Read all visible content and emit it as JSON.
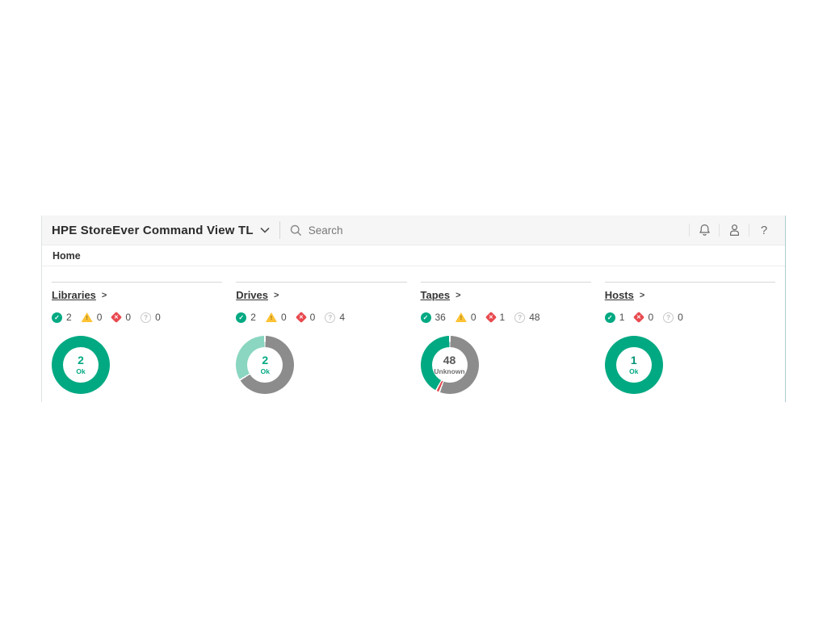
{
  "app": {
    "title": "HPE StoreEver Command View TL",
    "search_placeholder": "Search",
    "breadcrumb": "Home"
  },
  "ui": {
    "link_arrow": ">",
    "help_glyph": "?"
  },
  "status_glyphs": {
    "ok": "✓",
    "warning": "!",
    "error": "✕",
    "unknown": "?"
  },
  "status_colors": {
    "ok": "#01a982",
    "ok_light": "#8ad6c0",
    "warning": "#fdc234",
    "error": "#e8494f",
    "unknown": "#8c8c8c"
  },
  "panels": [
    {
      "title": "Libraries",
      "statuses": [
        {
          "type": "ok",
          "count": "2"
        },
        {
          "type": "warning",
          "count": "0"
        },
        {
          "type": "error",
          "count": "0"
        },
        {
          "type": "unknown",
          "count": "0"
        }
      ],
      "donut": {
        "center_value": "2",
        "center_label": "Ok",
        "center_value_color": "#01a982",
        "center_label_color": "#01a982",
        "segments": [
          {
            "label": "ok",
            "value": 2,
            "color": "#01a982"
          }
        ]
      }
    },
    {
      "title": "Drives",
      "statuses": [
        {
          "type": "ok",
          "count": "2"
        },
        {
          "type": "warning",
          "count": "0"
        },
        {
          "type": "error",
          "count": "0"
        },
        {
          "type": "unknown",
          "count": "4"
        }
      ],
      "donut": {
        "center_value": "2",
        "center_label": "Ok",
        "center_value_color": "#01a982",
        "center_label_color": "#01a982",
        "segments": [
          {
            "label": "unknown",
            "value": 4,
            "color": "#8c8c8c"
          },
          {
            "label": "ok",
            "value": 2,
            "color": "#8ad6c0"
          }
        ]
      }
    },
    {
      "title": "Tapes",
      "statuses": [
        {
          "type": "ok",
          "count": "36"
        },
        {
          "type": "warning",
          "count": "0"
        },
        {
          "type": "error",
          "count": "1"
        },
        {
          "type": "unknown",
          "count": "48"
        }
      ],
      "donut": {
        "center_value": "48",
        "center_label": "Unknown",
        "center_value_color": "#585858",
        "center_label_color": "#6f6f6f",
        "segments": [
          {
            "label": "unknown",
            "value": 48,
            "color": "#8c8c8c"
          },
          {
            "label": "error",
            "value": 1,
            "color": "#e0494f"
          },
          {
            "label": "ok",
            "value": 36,
            "color": "#01a982"
          }
        ]
      }
    },
    {
      "title": "Hosts",
      "statuses": [
        {
          "type": "ok",
          "count": "1"
        },
        {
          "type": "error",
          "count": "0"
        },
        {
          "type": "unknown",
          "count": "0"
        }
      ],
      "donut": {
        "center_value": "1",
        "center_label": "Ok",
        "center_value_color": "#019378",
        "center_label_color": "#01a982",
        "segments": [
          {
            "label": "ok",
            "value": 1,
            "color": "#01a982"
          }
        ]
      }
    }
  ]
}
